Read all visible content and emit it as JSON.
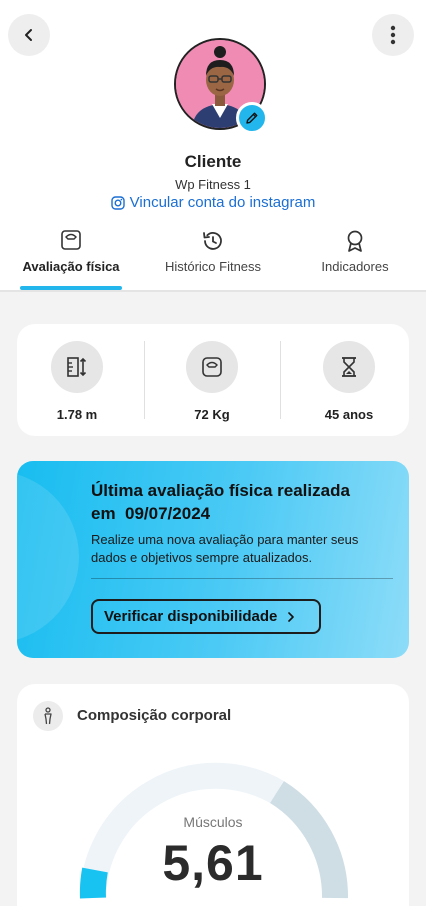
{
  "header": {
    "client_name": "Cliente",
    "gym_name": "Wp Fitness 1",
    "instagram_link": "Vincular conta do instagram"
  },
  "tabs": [
    {
      "label": "Avaliação física",
      "icon": "scale-icon",
      "active": true
    },
    {
      "label": "Histórico Fitness",
      "icon": "history-icon",
      "active": false
    },
    {
      "label": "Indicadores",
      "icon": "award-icon",
      "active": false
    }
  ],
  "stats": [
    {
      "value": "1.78 m",
      "icon": "height-icon"
    },
    {
      "value": "72 Kg",
      "icon": "weight-scale-icon"
    },
    {
      "value": "45 anos",
      "icon": "hourglass-icon"
    }
  ],
  "evaluation": {
    "title_line1": "Última avaliação física realizada",
    "title_line2": "em  09/07/2024",
    "description": "Realize uma nova avaliação para manter seus dados e objetivos sempre atualizados.",
    "button_label": "Verificar disponibilidade"
  },
  "composition": {
    "title": "Composição corporal",
    "gauge_label": "Músculos",
    "gauge_value": "5,61"
  },
  "colors": {
    "accent": "#23b6ec",
    "link": "#1b6fd3",
    "avatar_bg": "#f08bb3"
  }
}
